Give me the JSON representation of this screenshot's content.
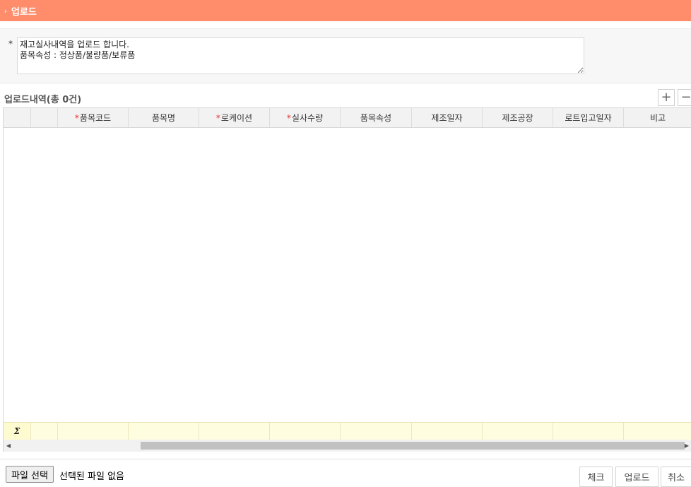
{
  "window": {
    "title": "업로드"
  },
  "notice": {
    "marker": "*",
    "text": "재고실사내역을 업로드 합니다.\n품목속성 : 정상품/불량품/보류품"
  },
  "grid": {
    "title": "업로드내역(총 0건)",
    "add_label": "+",
    "remove_label": "−",
    "columns": [
      {
        "label": "",
        "required": false
      },
      {
        "label": "",
        "required": false
      },
      {
        "label": "품목코드",
        "required": true
      },
      {
        "label": "품목명",
        "required": false
      },
      {
        "label": "로케이션",
        "required": true
      },
      {
        "label": "실사수량",
        "required": true
      },
      {
        "label": "품목속성",
        "required": false
      },
      {
        "label": "제조일자",
        "required": false
      },
      {
        "label": "제조공장",
        "required": false
      },
      {
        "label": "로트입고일자",
        "required": false
      },
      {
        "label": "비고",
        "required": false
      }
    ],
    "rows": [],
    "sum_symbol": "Σ",
    "scroll_left_icon": "◀",
    "scroll_right_icon": "▶"
  },
  "file": {
    "button_label": "파일 선택",
    "status": "선택된 파일 없음"
  },
  "actions": {
    "check_label": "체크",
    "upload_label": "업로드",
    "cancel_label": "취소"
  },
  "colors": {
    "titlebar": "#ff8c6b",
    "required_mark": "#e0322d",
    "sum_row": "#fffde0"
  }
}
